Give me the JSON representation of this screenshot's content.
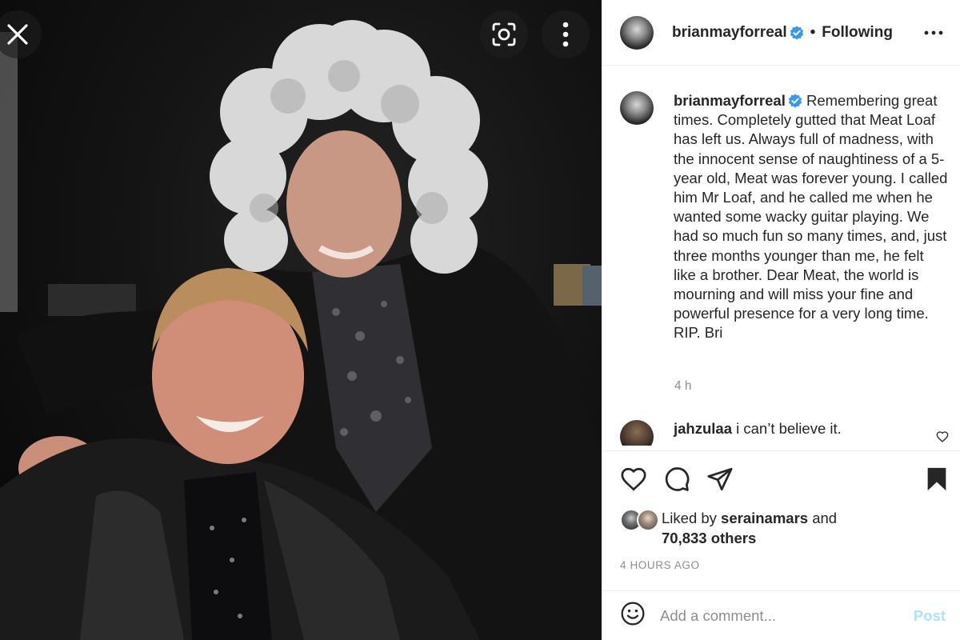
{
  "post": {
    "username": "brianmayforreal",
    "follow_label": "Following",
    "separator": "•",
    "caption": "Remembering great times. Completely gutted that Meat Loaf has left us. Always full of madness, with the innocent sense of naughtiness of a 5-year old, Meat was forever young. I called him Mr Loaf, and he called me when he wanted some wacky guitar playing. We had so much fun so many times, and, just three months younger than me, he felt like a brother. Dear Meat, the world is mourning and will miss your fine and powerful presence for a very long time. RIP. Bri",
    "caption_time": "4 h",
    "posted_ago": "4 HOURS AGO"
  },
  "comment": {
    "username": "jahzulaa",
    "text": "i can’t believe it."
  },
  "likes": {
    "prefix": "Liked by",
    "user": "serainamars",
    "joiner": "and",
    "count": "70,833 others"
  },
  "composer": {
    "placeholder": "Add a comment...",
    "post_label": "Post"
  },
  "icons": {
    "close": "close-icon",
    "lens": "visual-search-icon",
    "more_photo": "more-vertical-icon",
    "more_header": "more-horizontal-icon",
    "verified": "verified-badge-icon",
    "like": "heart-icon",
    "comment": "comment-icon",
    "share": "share-icon",
    "save": "bookmark-icon",
    "emoji": "emoji-icon"
  },
  "colors": {
    "verified_blue": "#3897f0",
    "post_disabled": "#b2dffc",
    "muted_text": "#8e8e8e"
  }
}
